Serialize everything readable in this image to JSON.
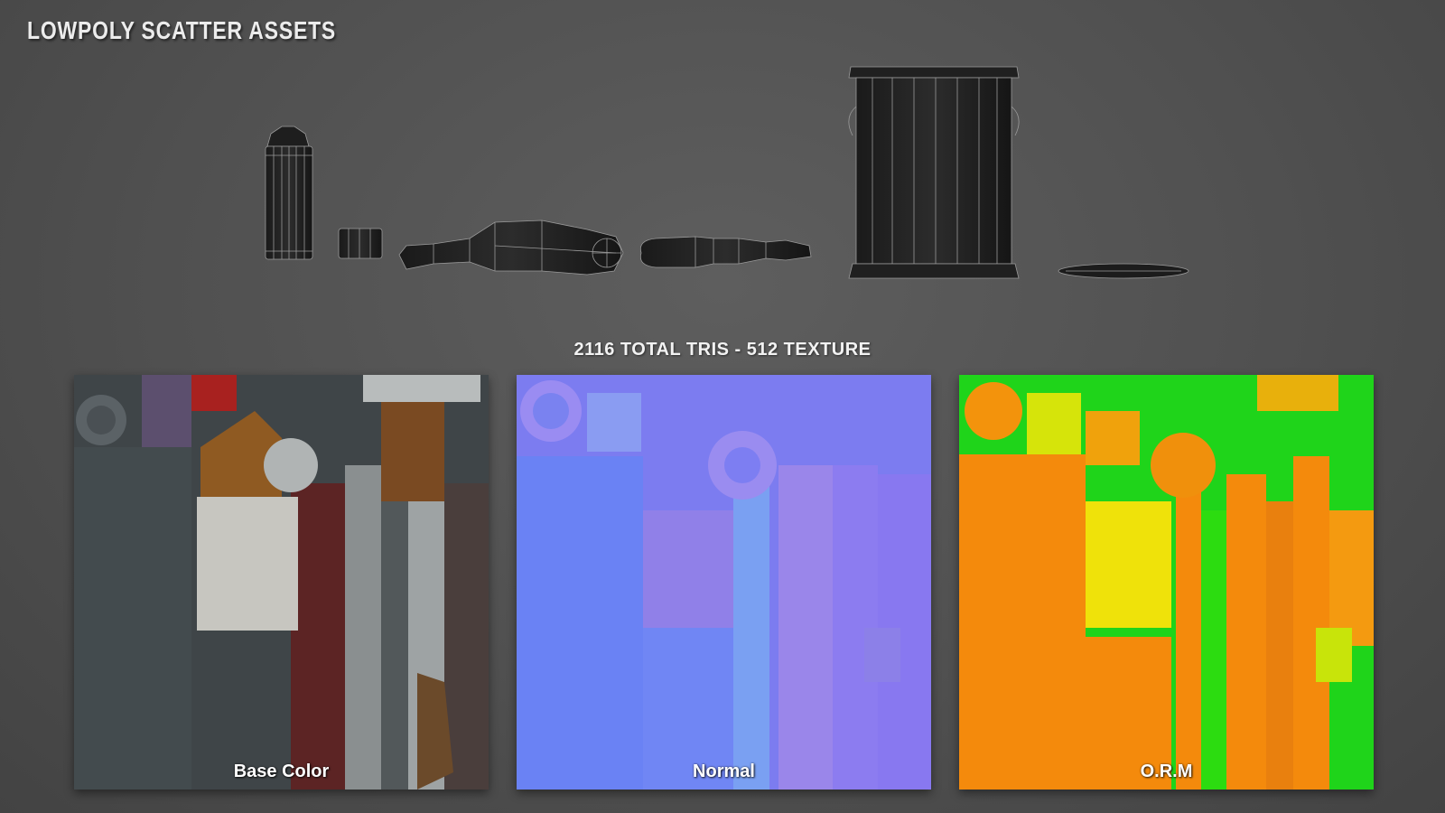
{
  "title": "LOWPOLY SCATTER ASSETS",
  "stats_caption": "2116 TOTAL TRIS - 512 TEXTURE",
  "assets": [
    {
      "name": "spray-can",
      "icon": "spray-can-wireframe"
    },
    {
      "name": "cap",
      "icon": "cap-wireframe"
    },
    {
      "name": "broom-handle",
      "icon": "broom-wireframe"
    },
    {
      "name": "brush",
      "icon": "brush-wireframe"
    },
    {
      "name": "paint-bucket",
      "icon": "bucket-wireframe"
    },
    {
      "name": "lid",
      "icon": "lid-wireframe"
    }
  ],
  "texture_maps": [
    {
      "label": "Base Color",
      "base": "#3f4548"
    },
    {
      "label": "Normal",
      "base": "#7c7cf0"
    },
    {
      "label": "O.R.M",
      "base": "#f48a0c"
    }
  ]
}
